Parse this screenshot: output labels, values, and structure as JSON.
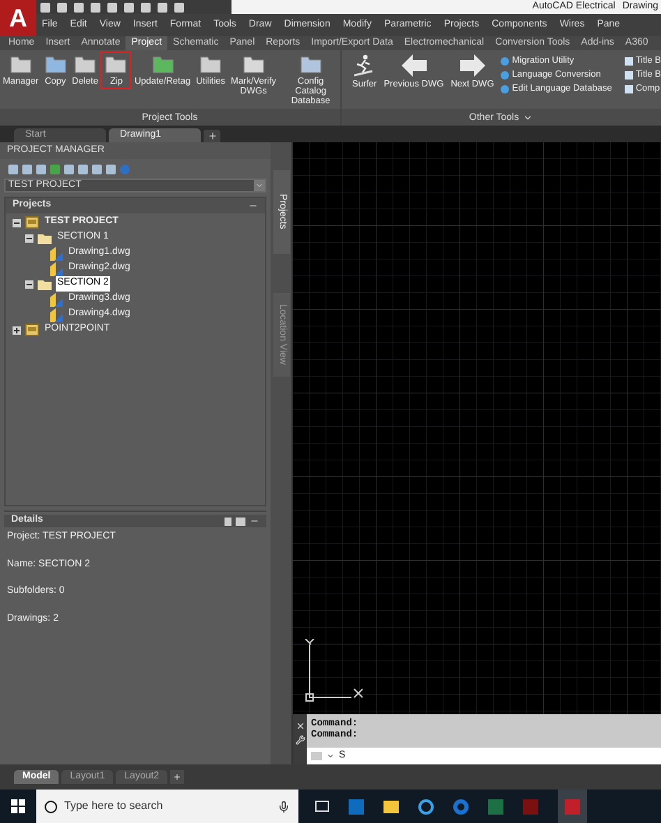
{
  "title_bar": {
    "logo_letter": "A",
    "app_title": "AutoCAD Electrical",
    "doc_title": "Drawing"
  },
  "menu_bar": [
    "File",
    "Edit",
    "View",
    "Insert",
    "Format",
    "Tools",
    "Draw",
    "Dimension",
    "Modify",
    "Parametric",
    "Projects",
    "Components",
    "Wires",
    "Pane"
  ],
  "ribbon_tabs": [
    {
      "label": "Home",
      "selected": false
    },
    {
      "label": "Insert",
      "selected": false
    },
    {
      "label": "Annotate",
      "selected": false
    },
    {
      "label": "Project",
      "selected": true
    },
    {
      "label": "Schematic",
      "selected": false
    },
    {
      "label": "Panel",
      "selected": false
    },
    {
      "label": "Reports",
      "selected": false
    },
    {
      "label": "Import/Export Data",
      "selected": false
    },
    {
      "label": "Electromechanical",
      "selected": false
    },
    {
      "label": "Conversion Tools",
      "selected": false
    },
    {
      "label": "Add-ins",
      "selected": false
    },
    {
      "label": "A360",
      "selected": false
    }
  ],
  "project_tools": {
    "title": "Project Tools",
    "buttons": [
      {
        "label": "Manager",
        "highlighted": false
      },
      {
        "label": "Copy",
        "highlighted": false
      },
      {
        "label": "Delete",
        "highlighted": false
      },
      {
        "label": "Zip",
        "highlighted": true
      },
      {
        "label": "Update/Retag",
        "highlighted": false
      },
      {
        "label": "Utilities",
        "highlighted": false
      },
      {
        "label": "Mark/Verify\nDWGs",
        "highlighted": false
      },
      {
        "label": "Config Catalog\nDatabase",
        "highlighted": false
      }
    ]
  },
  "other_tools": {
    "title": "Other Tools",
    "has_menu": true,
    "buttons": [
      {
        "label": "Surfer"
      },
      {
        "label": "Previous DWG"
      },
      {
        "label": "Next DWG"
      }
    ],
    "small_buttons": [
      "Migration Utility",
      "Language Conversion",
      "Edit Language Database"
    ],
    "cut_buttons": [
      "Title B",
      "Title B",
      "Comp"
    ]
  },
  "doc_tabs": [
    {
      "label": "Start",
      "selected": false
    },
    {
      "label": "Drawing1",
      "selected": true
    }
  ],
  "project_manager": {
    "title": "PROJECT MANAGER",
    "project_select": "TEST PROJECT",
    "projects_header": "Projects",
    "tree": [
      {
        "label": "TEST PROJECT",
        "kind": "project",
        "active": true,
        "expanded": true,
        "selected": false,
        "children": [
          {
            "label": "SECTION 1",
            "kind": "folder",
            "expanded": true,
            "selected": false,
            "children": [
              {
                "label": "Drawing1.dwg",
                "kind": "drawing",
                "selected": false
              },
              {
                "label": "Drawing2.dwg",
                "kind": "drawing",
                "selected": false
              }
            ]
          },
          {
            "label": "SECTION 2",
            "kind": "folder",
            "expanded": true,
            "selected": true,
            "children": [
              {
                "label": "Drawing3.dwg",
                "kind": "drawing",
                "selected": false
              },
              {
                "label": "Drawing4.dwg",
                "kind": "drawing",
                "selected": false
              }
            ]
          }
        ]
      },
      {
        "label": "POINT2POINT",
        "kind": "project",
        "active": false,
        "expanded": false,
        "selected": false
      }
    ]
  },
  "side_tabs": [
    {
      "label": "Projects",
      "selected": true
    },
    {
      "label": "Location View",
      "selected": false
    }
  ],
  "details": {
    "title": "Details",
    "lines": [
      "Project: TEST PROJECT",
      "Name: SECTION 2",
      "Subfolders: 0",
      "Drawings: 2"
    ]
  },
  "command": {
    "history": [
      "Command:",
      "Command:"
    ],
    "input": "S"
  },
  "layout_tabs": [
    {
      "label": "Model",
      "selected": true
    },
    {
      "label": "Layout1",
      "selected": false
    },
    {
      "label": "Layout2",
      "selected": false
    }
  ],
  "taskbar": {
    "search_placeholder": "Type here to search"
  }
}
